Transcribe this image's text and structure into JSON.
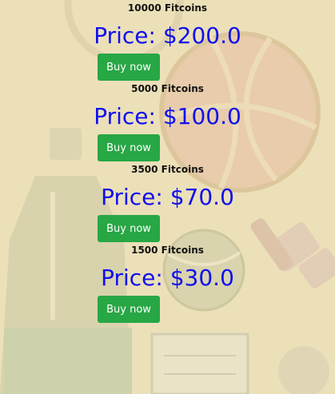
{
  "offers": [
    {
      "coins_label": "10000 Fitcoins",
      "price_label": "Price: $200.0",
      "button_label": "Buy now"
    },
    {
      "coins_label": "5000 Fitcoins",
      "price_label": "Price: $100.0",
      "button_label": "Buy now"
    },
    {
      "coins_label": "3500 Fitcoins",
      "price_label": "Price: $70.0",
      "button_label": "Buy now"
    },
    {
      "coins_label": "1500 Fitcoins",
      "price_label": "Price: $30.0",
      "button_label": "Buy now"
    }
  ],
  "colors": {
    "background": "#ece0b9",
    "price_text": "#1010ee",
    "button": "#28a745"
  }
}
